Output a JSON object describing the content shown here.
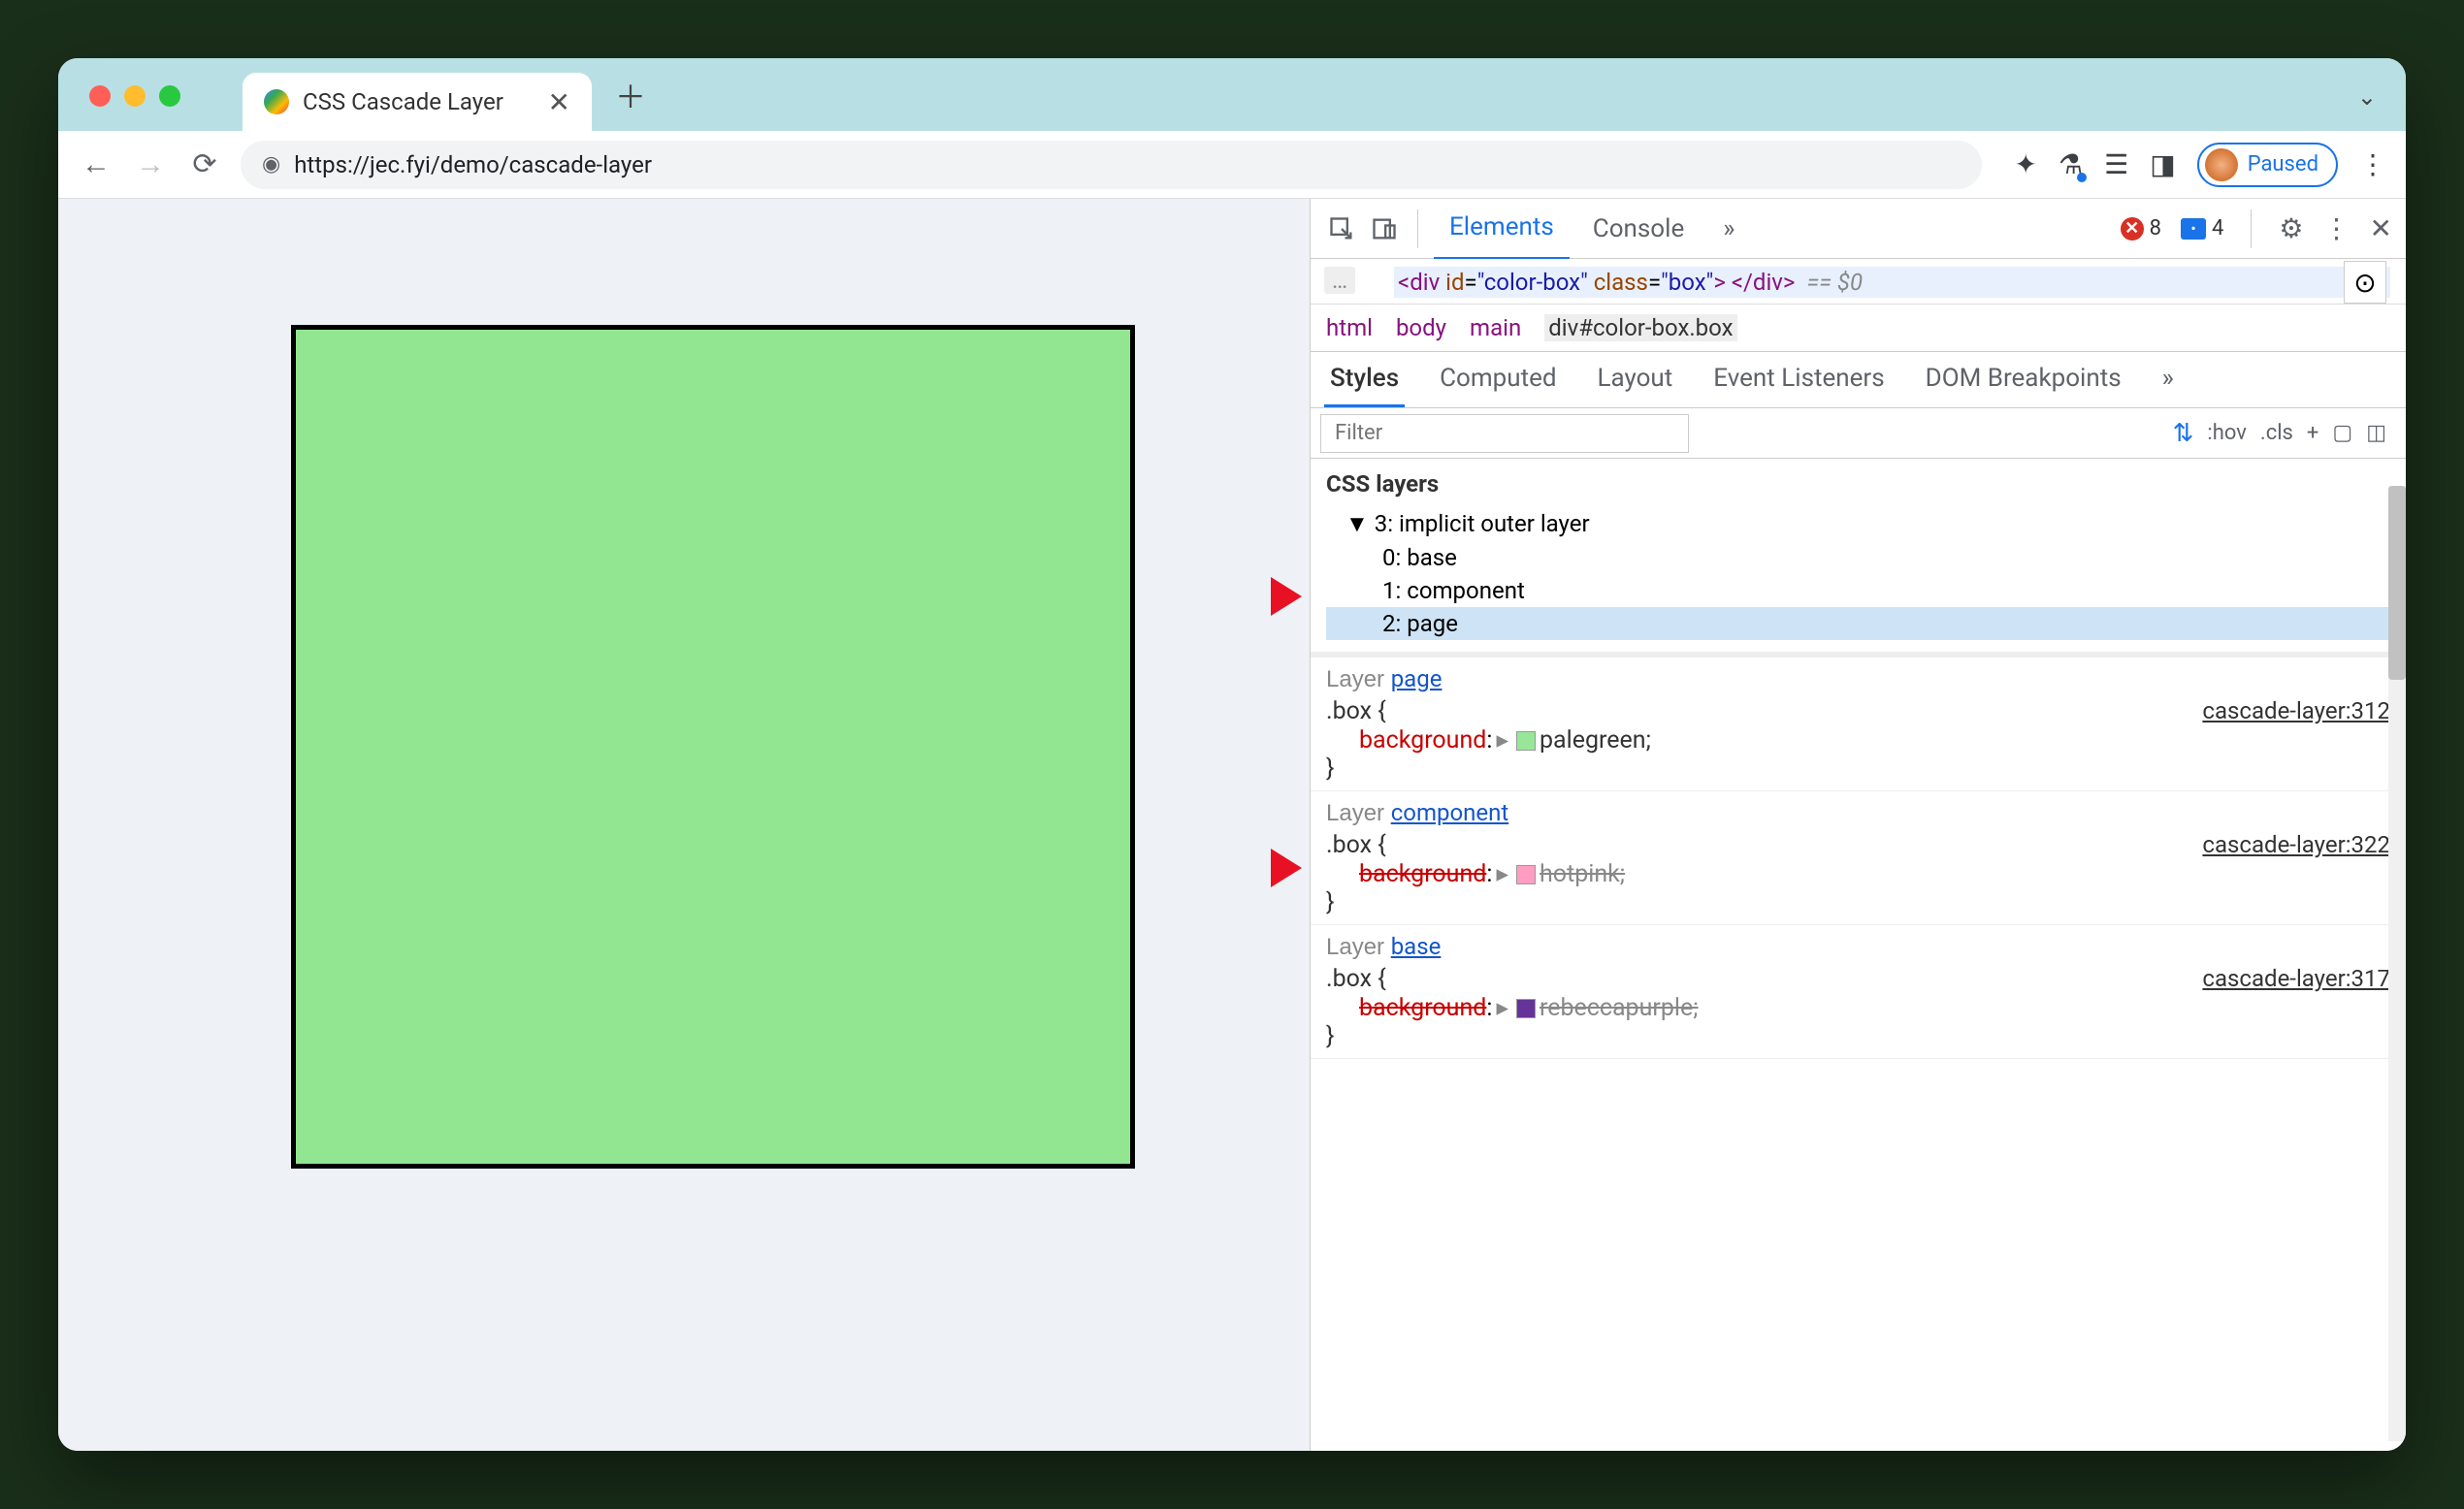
{
  "tab": {
    "title": "CSS Cascade Layer"
  },
  "url": "https://jec.fyi/demo/cascade-layer",
  "paused_label": "Paused",
  "devtools": {
    "top_tabs": [
      "Elements",
      "Console"
    ],
    "active_top_tab": "Elements",
    "errors": "8",
    "messages": "4",
    "dom_line": {
      "tag_open": "<div",
      "attrs": " id=\"color-box\" class=\"box\"",
      "tag_close": "> </div>",
      "suffix": "== $0"
    },
    "breadcrumbs": [
      "html",
      "body",
      "main",
      "div#color-box.box"
    ],
    "styles_tabs": [
      "Styles",
      "Computed",
      "Layout",
      "Event Listeners",
      "DOM Breakpoints"
    ],
    "active_styles_tab": "Styles",
    "filter_placeholder": "Filter",
    "filter_tools": [
      ":hov",
      ".cls",
      "+"
    ],
    "layers": {
      "section_title": "CSS layers",
      "root": "3: implicit outer layer",
      "items": [
        "0: base",
        "1: component",
        "2: page"
      ],
      "selected_index": 2
    },
    "rules": [
      {
        "layer_label": "Layer ",
        "layer_link": "page",
        "selector": ".box",
        "source": "cascade-layer:312",
        "prop": "background",
        "value": "palegreen",
        "swatch": "#98e698",
        "struck": false
      },
      {
        "layer_label": "Layer ",
        "layer_link": "component",
        "selector": ".box",
        "source": "cascade-layer:322",
        "prop": "background",
        "value": "hotpink",
        "swatch": "#ff9ec1",
        "struck": true
      },
      {
        "layer_label": "Layer ",
        "layer_link": "base",
        "selector": ".box",
        "source": "cascade-layer:317",
        "prop": "background",
        "value": "rebeccapurple",
        "swatch": "#663399",
        "struck": true
      }
    ]
  }
}
